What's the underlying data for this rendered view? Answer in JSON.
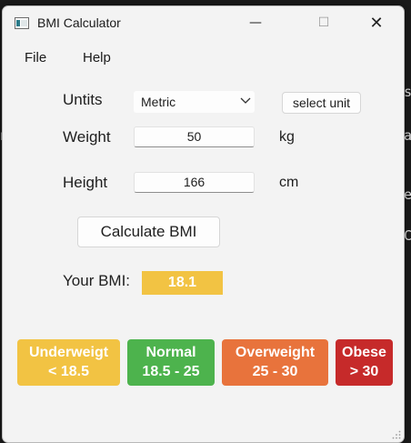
{
  "window": {
    "title": "BMI Calculator",
    "controls": {
      "minimize": "—",
      "maximize": "☐",
      "close": "✕"
    }
  },
  "menu": {
    "items": [
      "File",
      "Help"
    ]
  },
  "form": {
    "units_label": "Untits",
    "units_selected": "Metric",
    "select_unit_button": "select unit",
    "weight_label": "Weight",
    "weight_value": "50",
    "weight_unit": "kg",
    "height_label": "Height",
    "height_value": "166",
    "height_unit": "cm",
    "calculate_button": "Calculate BMI",
    "result_label": "Your BMI:",
    "result_value": "18.1"
  },
  "categories": [
    {
      "name": "Underweigt",
      "range": "< 18.5",
      "color": "#f2c343"
    },
    {
      "name": "Normal",
      "range": "18.5 - 25",
      "color": "#4db34d"
    },
    {
      "name": "Overweight",
      "range": "25 - 30",
      "color": "#e8733c"
    },
    {
      "name": "Obese",
      "range": "> 30",
      "color": "#c62a2a"
    }
  ],
  "colors": {
    "window_bg": "#f3f3f3",
    "bmi_highlight": "#f2c343"
  }
}
